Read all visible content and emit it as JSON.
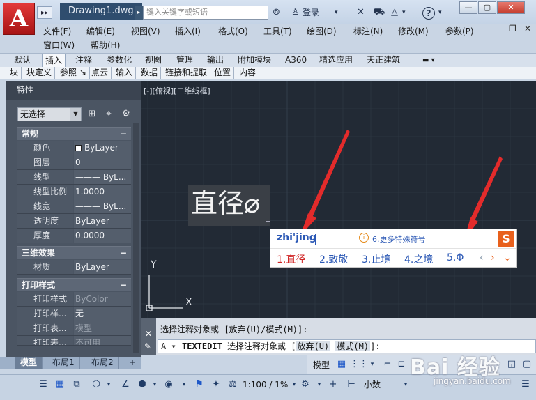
{
  "titlebar": {
    "app_logo": "A",
    "document_tab": "Drawing1.dwg",
    "search_placeholder": "键入关键字或短语",
    "login_label": "登录",
    "help_label": "?"
  },
  "menubar": {
    "row1": [
      "文件(F)",
      "编辑(E)",
      "视图(V)",
      "插入(I)",
      "格式(O)",
      "工具(T)",
      "绘图(D)",
      "标注(N)",
      "修改(M)",
      "参数(P)"
    ],
    "row2": [
      "窗口(W)",
      "帮助(H)"
    ]
  },
  "ribbon": {
    "tabs": [
      "默认",
      "插入",
      "注释",
      "参数化",
      "视图",
      "管理",
      "输出",
      "附加模块",
      "A360",
      "精选应用",
      "天正建筑"
    ],
    "active_tab": "插入",
    "panels": [
      "块",
      "块定义",
      "参照 ↘",
      "点云",
      "输入",
      "数据",
      "链接和提取",
      "位置",
      "内容"
    ]
  },
  "properties": {
    "title": "特性",
    "selection": "无选择",
    "sections": [
      {
        "title": "常规",
        "rows": [
          {
            "name": "颜色",
            "value": "ByLayer"
          },
          {
            "name": "图层",
            "value": "0"
          },
          {
            "name": "线型",
            "value": "——— ByL..."
          },
          {
            "name": "线型比例",
            "value": "1.0000"
          },
          {
            "name": "线宽",
            "value": "——— ByL..."
          },
          {
            "name": "透明度",
            "value": "ByLayer"
          },
          {
            "name": "厚度",
            "value": "0.0000"
          }
        ]
      },
      {
        "title": "三维效果",
        "rows": [
          {
            "name": "材质",
            "value": "ByLayer"
          }
        ]
      },
      {
        "title": "打印样式",
        "rows": [
          {
            "name": "打印样式",
            "value": "ByColor"
          },
          {
            "name": "打印样...",
            "value": "无"
          },
          {
            "name": "打印表...",
            "value": "模型"
          },
          {
            "name": "打印表...",
            "value": "不可用"
          }
        ]
      }
    ]
  },
  "layout_tabs": [
    "模型",
    "布局1",
    "布局2",
    "+"
  ],
  "canvas": {
    "view_label": "[-][俯视][二维线框]",
    "text_entity": "直径⌀",
    "axis_y": "Y",
    "axis_x": "X"
  },
  "ime": {
    "input": "zhi'jing",
    "tip": "6.更多特殊符号",
    "candidates": [
      "1.直径",
      "2.致敬",
      "3.止境",
      "4.之境",
      "5.Φ"
    ],
    "nav": [
      "‹",
      "›",
      "⌄"
    ]
  },
  "command": {
    "history": "选择注释对象或 [放弃(U)/模式(M)]:",
    "prompt_cmd": "TEXTEDIT",
    "prompt_text": "选择注释对象或 [",
    "opt1": "放弃(U)",
    "opt2": "模式(M)",
    "prompt_end": "]:"
  },
  "status": {
    "model": "模型",
    "scale": "1:100 / 1%",
    "units": "小数"
  },
  "watermark": {
    "main": "Bai 经验",
    "sub": "jingyan.baidu.com"
  },
  "colors": {
    "canvas_bg": "#222a35",
    "accent_red": "#d02424",
    "ime_blue": "#2b58b5",
    "arrow_red": "#e32b2b"
  }
}
